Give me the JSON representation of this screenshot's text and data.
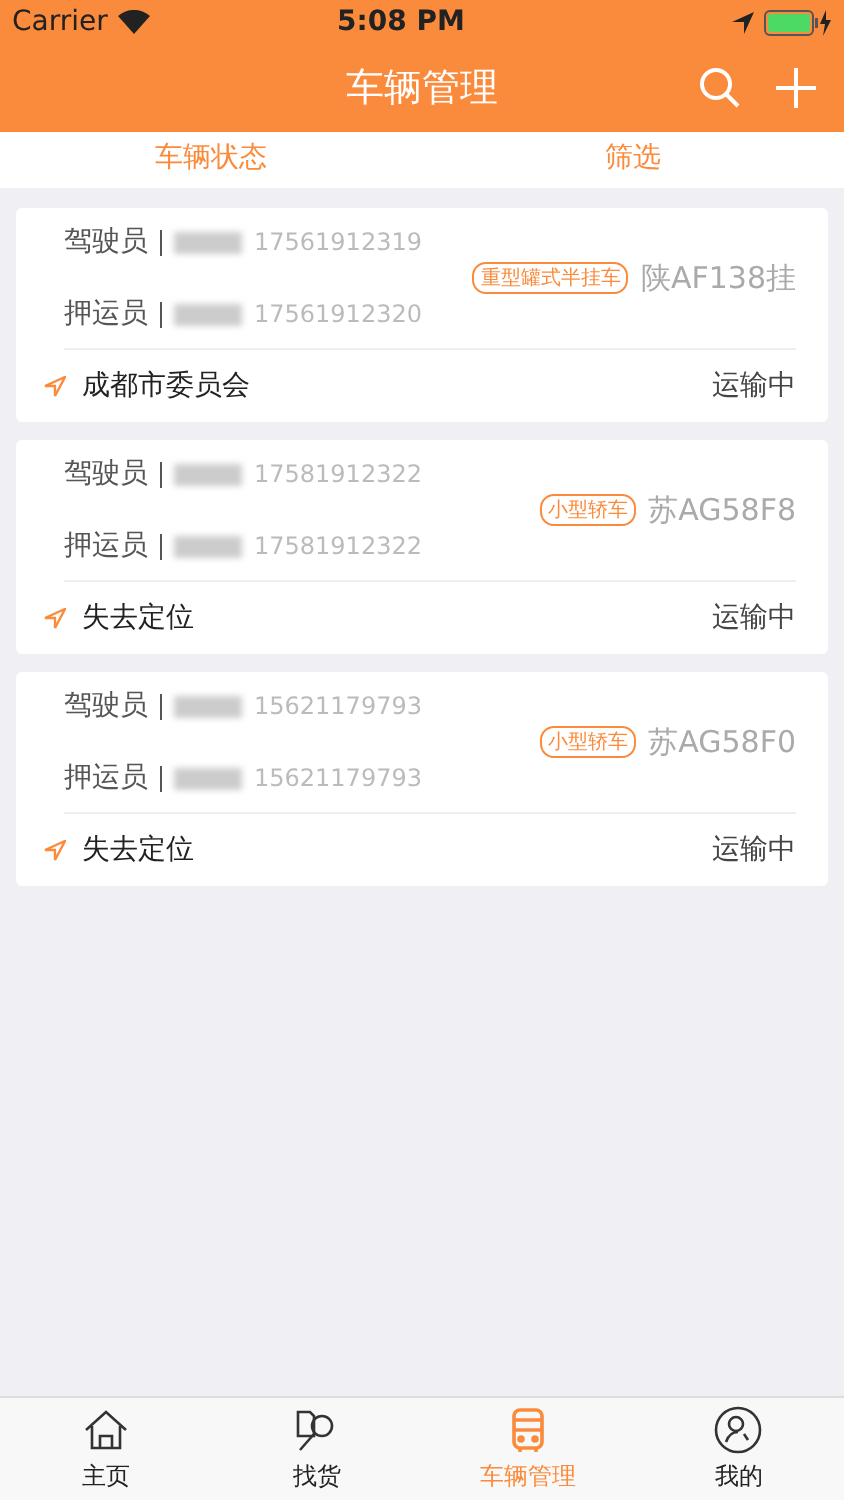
{
  "status_bar": {
    "carrier": "Carrier",
    "time": "5:08 PM"
  },
  "nav": {
    "title": "车辆管理"
  },
  "tabs": [
    {
      "label": "车辆状态",
      "selected": false
    },
    {
      "label": "筛选",
      "selected": false
    }
  ],
  "vehicles": [
    {
      "driver_label": "驾驶员",
      "driver_phone": "17561912319",
      "escort_label": "押运员",
      "escort_phone": "17561912320",
      "type": "重型罐式半挂车",
      "plate": "陕AF138挂",
      "location": "成都市委员会",
      "status": "运输中"
    },
    {
      "driver_label": "驾驶员",
      "driver_phone": "17581912322",
      "escort_label": "押运员",
      "escort_phone": "17581912322",
      "type": "小型轿车",
      "plate": "苏AG58F8",
      "location": "失去定位",
      "status": "运输中"
    },
    {
      "driver_label": "驾驶员",
      "driver_phone": "15621179793",
      "escort_label": "押运员",
      "escort_phone": "15621179793",
      "type": "小型轿车",
      "plate": "苏AG58F0",
      "location": "失去定位",
      "status": "运输中"
    }
  ],
  "tab_bar": [
    {
      "label": "主页",
      "selected": false
    },
    {
      "label": "找货",
      "selected": false
    },
    {
      "label": "车辆管理",
      "selected": true
    },
    {
      "label": "我的",
      "selected": false
    }
  ]
}
